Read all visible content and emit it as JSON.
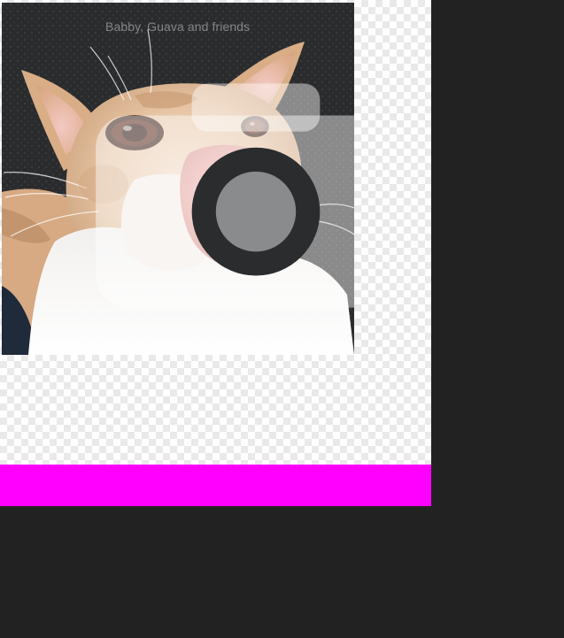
{
  "canvas": {
    "background": "transparent-checkerboard"
  },
  "photo": {
    "caption": "Babby, Guava and friends",
    "caption_icon": "camera-icon",
    "subject": "cat"
  },
  "accent_bar": {
    "color": "#ff00ff"
  },
  "workspace": {
    "background_color": "#222222"
  }
}
